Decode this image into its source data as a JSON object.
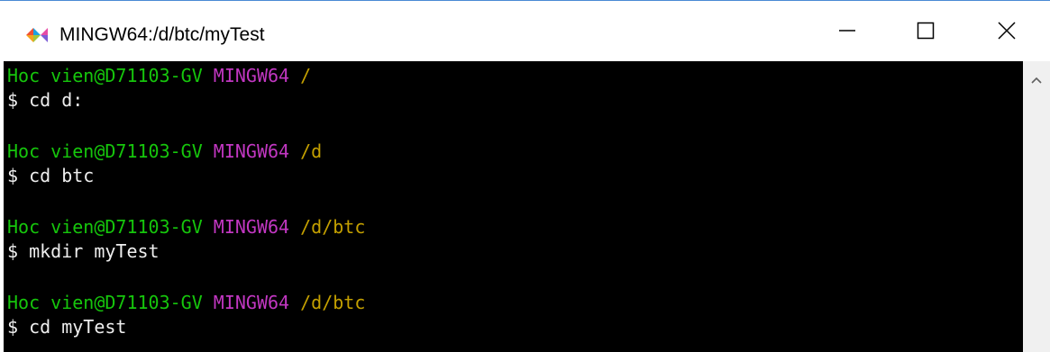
{
  "window": {
    "title": "MINGW64:/d/btc/myTest",
    "icon": "git-icon",
    "controls": {
      "minimize": "minimize-icon",
      "maximize": "maximize-icon",
      "close": "close-icon"
    }
  },
  "terminal": {
    "colors": {
      "user": "#16c60c",
      "mingw": "#c237c2",
      "path": "#c4a000",
      "command": "#eeeeee",
      "background": "#000000"
    },
    "entries": [
      {
        "user": "Hoc vien@D71103-GV",
        "env": "MINGW64",
        "path": "/",
        "command": "$ cd d:"
      },
      {
        "user": "Hoc vien@D71103-GV",
        "env": "MINGW64",
        "path": "/d",
        "command": "$ cd btc"
      },
      {
        "user": "Hoc vien@D71103-GV",
        "env": "MINGW64",
        "path": "/d/btc",
        "command": "$ mkdir myTest"
      },
      {
        "user": "Hoc vien@D71103-GV",
        "env": "MINGW64",
        "path": "/d/btc",
        "command": "$ cd myTest"
      }
    ]
  },
  "scrollbar": {
    "up_arrow": "chevron-up-icon"
  }
}
